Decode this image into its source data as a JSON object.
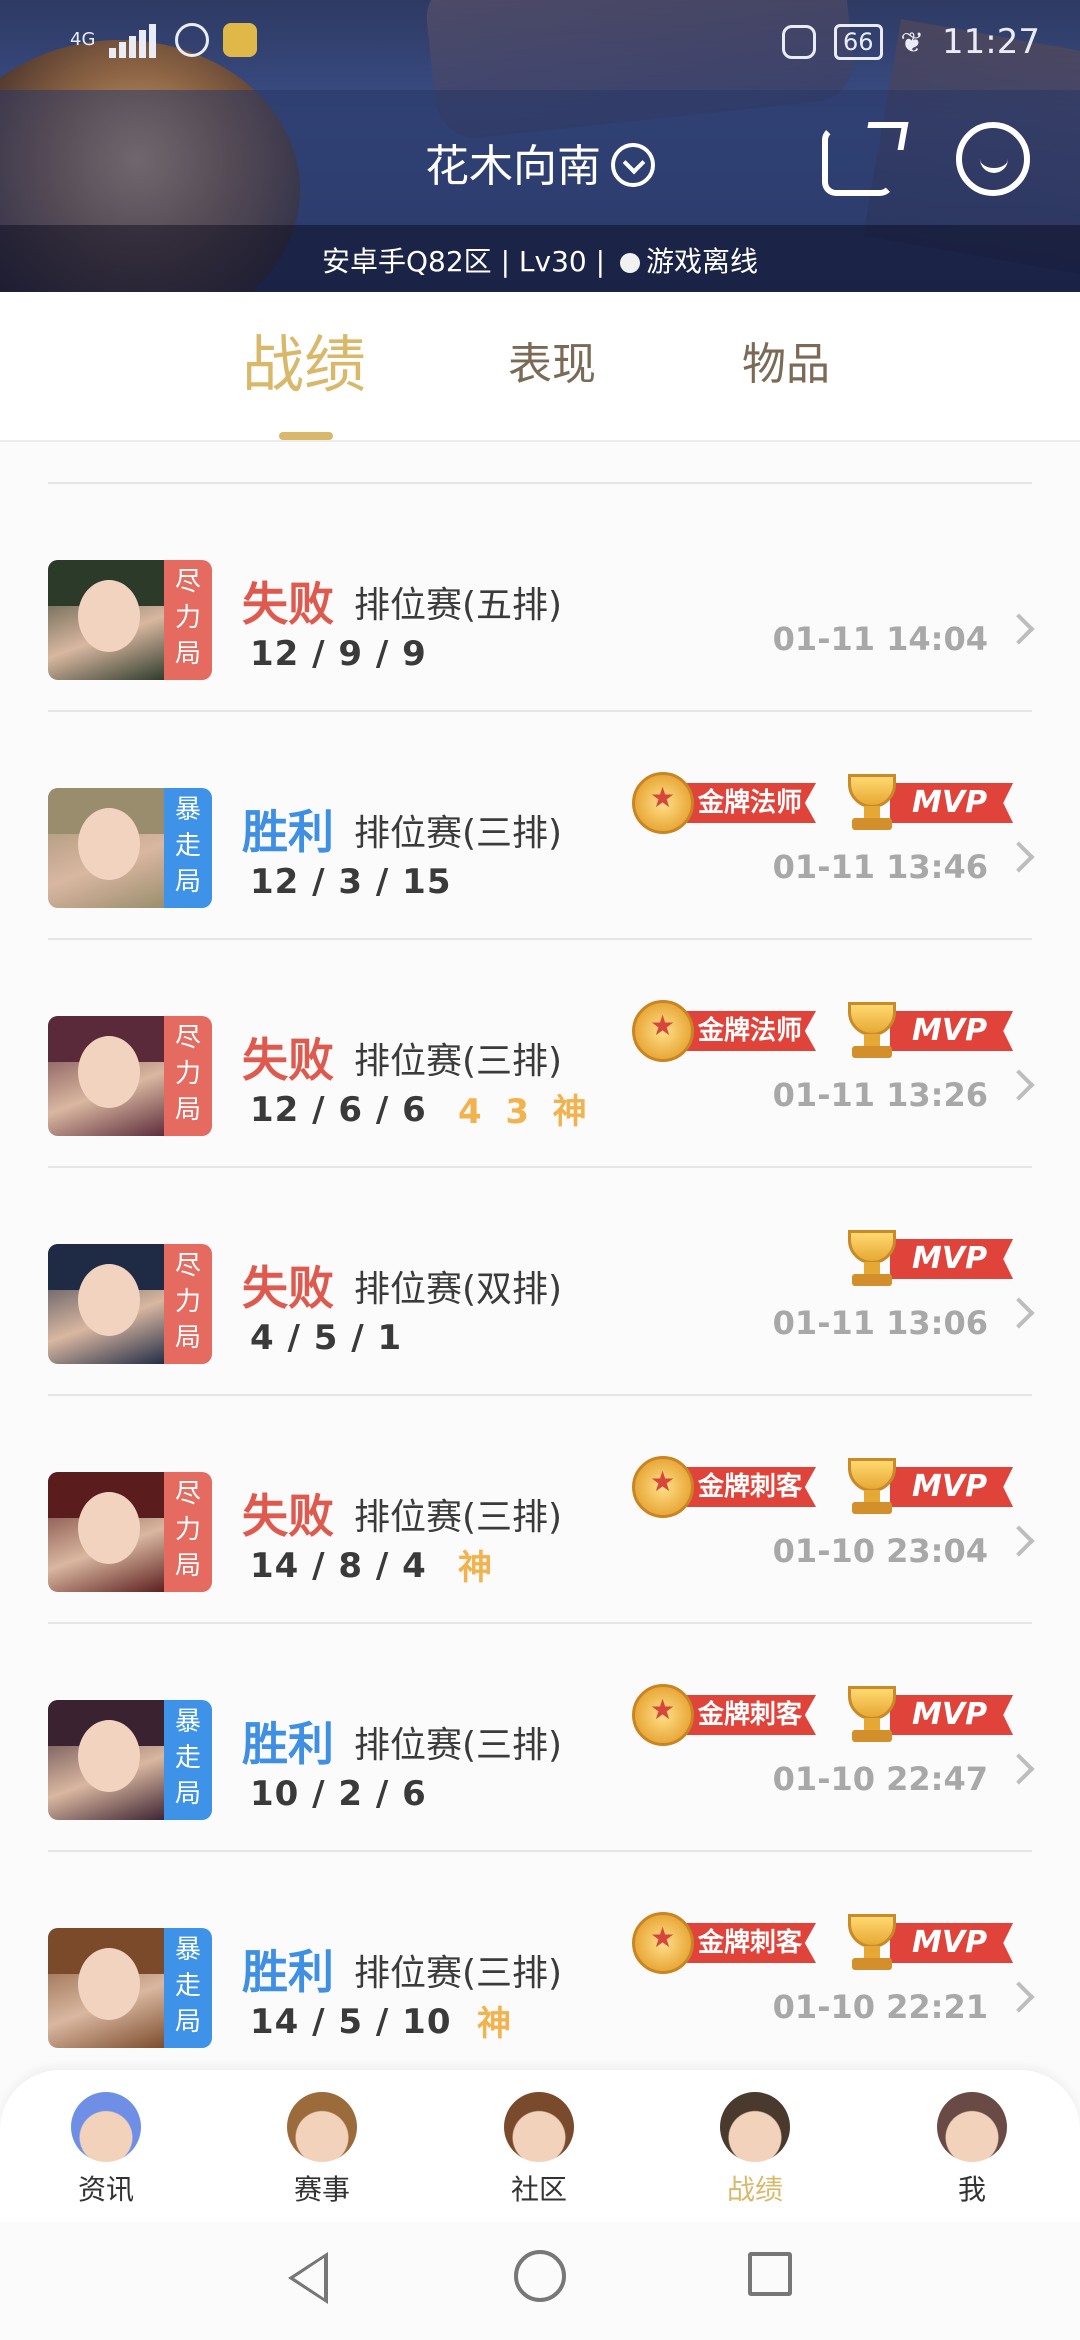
{
  "status_bar": {
    "network": "4G",
    "battery": "66",
    "time": "11:27"
  },
  "header": {
    "player_name": "花木向南",
    "server": "安卓手Q82区",
    "level": "Lv30",
    "separator": "|",
    "game_status": "游戏离线"
  },
  "tabs": [
    {
      "label": "战绩",
      "active": true
    },
    {
      "label": "表现",
      "active": false
    },
    {
      "label": "物品",
      "active": false
    }
  ],
  "matches": [
    {
      "mode": "尽\n力\n局",
      "mode_type": "lose",
      "result": "失败",
      "match_type": "排位赛(五排)",
      "kda": "12 / 9 / 9",
      "streaks": "",
      "badge": "",
      "mvp": "",
      "time": "01-11 14:04",
      "avatar_color": "#2c3a2a"
    },
    {
      "mode": "暴\n走\n局",
      "mode_type": "win",
      "result": "胜利",
      "match_type": "排位赛(三排)",
      "kda": "12 / 3 / 15",
      "streaks": "",
      "badge": "金牌法师",
      "mvp": "MVP",
      "time": "01-11 13:46",
      "avatar_color": "#9a8d6e"
    },
    {
      "mode": "尽\n力\n局",
      "mode_type": "lose",
      "result": "失败",
      "match_type": "排位赛(三排)",
      "kda": "12 / 6 / 6",
      "streaks": "4  3  神",
      "badge": "金牌法师",
      "mvp": "MVP",
      "time": "01-11 13:26",
      "avatar_color": "#5b2a3a"
    },
    {
      "mode": "尽\n力\n局",
      "mode_type": "lose",
      "result": "失败",
      "match_type": "排位赛(双排)",
      "kda": "4 / 5 / 1",
      "streaks": "",
      "badge": "",
      "mvp": "MVP",
      "time": "01-11 13:06",
      "avatar_color": "#1f2a45"
    },
    {
      "mode": "尽\n力\n局",
      "mode_type": "lose",
      "result": "失败",
      "match_type": "排位赛(三排)",
      "kda": "14 / 8 / 4",
      "streaks": "神",
      "badge": "金牌刺客",
      "mvp": "MVP",
      "time": "01-10 23:04",
      "avatar_color": "#5a1c1c"
    },
    {
      "mode": "暴\n走\n局",
      "mode_type": "win",
      "result": "胜利",
      "match_type": "排位赛(三排)",
      "kda": "10 / 2 / 6",
      "streaks": "",
      "badge": "金牌刺客",
      "mvp": "MVP",
      "time": "01-10 22:47",
      "avatar_color": "#3a2230"
    },
    {
      "mode": "暴\n走\n局",
      "mode_type": "win",
      "result": "胜利",
      "match_type": "排位赛(三排)",
      "kda": "14 / 5 / 10",
      "streaks": "神",
      "badge": "金牌刺客",
      "mvp": "MVP",
      "time": "01-10 22:21",
      "avatar_color": "#7a4a2a"
    }
  ],
  "bottom_nav": [
    {
      "label": "资讯",
      "icon": "news-character-icon",
      "active": false,
      "color": "#6f8fe6"
    },
    {
      "label": "赛事",
      "icon": "events-character-icon",
      "active": false,
      "color": "#9b6b3c"
    },
    {
      "label": "社区",
      "icon": "community-character-icon",
      "active": false,
      "color": "#7a4a2d"
    },
    {
      "label": "战绩",
      "icon": "record-character-icon",
      "active": true,
      "color": "#4a3a2e"
    },
    {
      "label": "我",
      "icon": "me-character-icon",
      "active": false,
      "color": "#6a4a45"
    }
  ],
  "colors": {
    "accent_gold": "#d9b86a",
    "lose_red": "#df5a4e",
    "win_blue": "#3f8fe3",
    "ribbon_red": "#e0433a"
  }
}
